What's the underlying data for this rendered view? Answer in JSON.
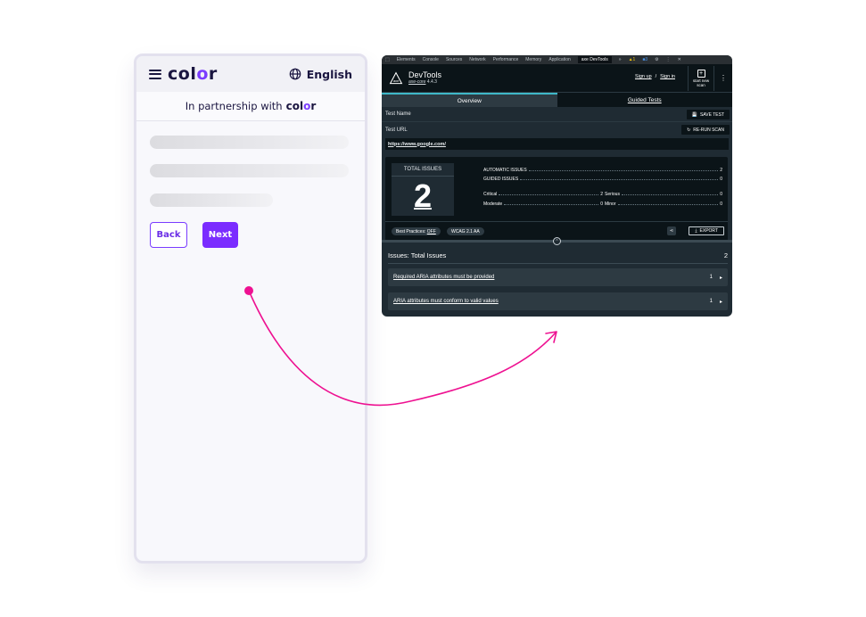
{
  "phone": {
    "logo_main": "col",
    "logo_o": "o",
    "logo_end": "r",
    "language": "English",
    "partner_text": "In partnership with",
    "back_label": "Back",
    "next_label": "Next"
  },
  "devtools": {
    "browser_tabs": [
      "Elements",
      "Console",
      "Sources",
      "Network",
      "Performance",
      "Memory",
      "Application",
      "axe DevTools",
      "»"
    ],
    "warn_count": "▲1",
    "info_count": "■3",
    "title": "DevTools",
    "version_engine": "axe-core",
    "version_num": "4.4.3",
    "sign_up": "Sign up",
    "sign_sep": "/",
    "sign_in": "Sign in",
    "new_scan_line1": "start new",
    "new_scan_line2": "scan",
    "tab_overview": "Overview",
    "tab_guided": "Guided Tests",
    "test_name_label": "Test Name",
    "save_test": "SAVE TEST",
    "test_url_label": "Test URL",
    "rerun_scan": "RE-RUN SCAN",
    "url": "https://www.google.com/",
    "total_issues_label": "TOTAL ISSUES",
    "total_issues": "2",
    "automatic_label": "AUTOMATIC ISSUES",
    "automatic_value": "2",
    "guided_label": "GUIDED ISSUES",
    "guided_value": "0",
    "critical_label": "Critical",
    "critical_value": "2",
    "serious_label": "Serious",
    "serious_value": "0",
    "moderate_label": "Moderate",
    "moderate_value": "0",
    "minor_label": "Minor",
    "minor_value": "0",
    "best_practices": "Best Practices:",
    "best_practices_state": "OFF",
    "wcag": "WCAG 2.1 AA",
    "export": "EXPORT",
    "issues_title": "Issues: Total Issues",
    "issues_count": "2",
    "issues": [
      {
        "text": "Required ARIA attributes must be provided",
        "count": "1"
      },
      {
        "text": "ARIA attributes must conform to valid values",
        "count": "1"
      }
    ]
  },
  "colors": {
    "brand_purple": "#7b2cff",
    "arrow_pink": "#ee1191",
    "devtools_bg": "#1f2b33"
  }
}
